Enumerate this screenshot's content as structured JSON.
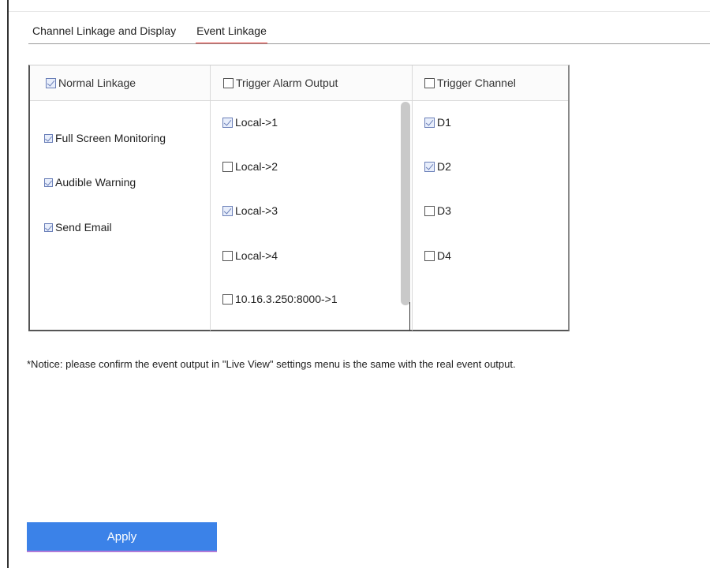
{
  "tabs": {
    "channel_linkage": "Channel Linkage and Display",
    "event_linkage": "Event Linkage"
  },
  "table": {
    "columns": [
      {
        "label": "Normal Linkage",
        "checked": true
      },
      {
        "label": "Trigger Alarm Output",
        "checked": false
      },
      {
        "label": "Trigger Channel",
        "checked": false
      }
    ],
    "normal_linkage": [
      {
        "label": "Full Screen Monitoring",
        "checked": true
      },
      {
        "label": "Audible Warning",
        "checked": true
      },
      {
        "label": "Send Email",
        "checked": true
      }
    ],
    "alarm_outputs": [
      {
        "label": "Local->1",
        "checked": true
      },
      {
        "label": "Local->2",
        "checked": false
      },
      {
        "label": "Local->3",
        "checked": true
      },
      {
        "label": "Local->4",
        "checked": false
      },
      {
        "label": "10.16.3.250:8000->1",
        "checked": false
      }
    ],
    "channels": [
      {
        "label": "D1",
        "checked": true
      },
      {
        "label": "D2",
        "checked": true
      },
      {
        "label": "D3",
        "checked": false
      },
      {
        "label": "D4",
        "checked": false
      }
    ]
  },
  "notice": "*Notice: please confirm the event output in \"Live View\" settings menu is the same with the real event output.",
  "apply_label": "Apply",
  "colors": {
    "accent": "#3b82e8",
    "tab_underline": "#e53935",
    "checkbox_checked": "#6a7fb8"
  }
}
